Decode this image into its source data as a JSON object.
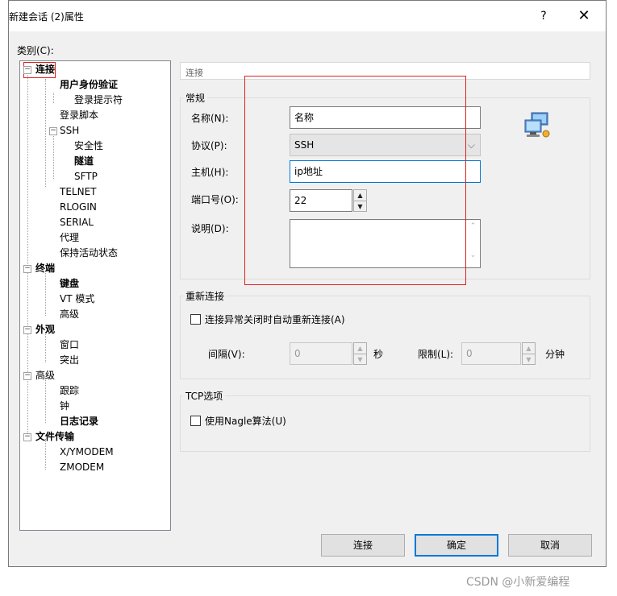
{
  "window": {
    "title": "新建会话 (2)属性",
    "help": "?",
    "close": "✕"
  },
  "category_label": "类别(C):",
  "tree": {
    "connection": "连接",
    "auth": "用户身份验证",
    "login_prompt": "登录提示符",
    "login_script": "登录脚本",
    "ssh": "SSH",
    "security": "安全性",
    "tunnel": "隧道",
    "sftp": "SFTP",
    "telnet": "TELNET",
    "rlogin": "RLOGIN",
    "serial": "SERIAL",
    "proxy": "代理",
    "keepalive": "保持活动状态",
    "terminal": "终端",
    "keyboard": "键盘",
    "vt_mode": "VT 模式",
    "term_advanced": "高级",
    "appearance": "外观",
    "window": "窗口",
    "highlight": "突出",
    "advanced": "高级",
    "trace": "跟踪",
    "bell": "钟",
    "logging": "日志记录",
    "file_transfer": "文件传输",
    "xymodem": "X/YMODEM",
    "zmodem": "ZMODEM"
  },
  "panel": {
    "header": "连接"
  },
  "general": {
    "title": "常规",
    "name_label": "名称(N):",
    "name_value": "名称",
    "protocol_label": "协议(P):",
    "protocol_value": "SSH",
    "host_label": "主机(H):",
    "host_value": "ip地址",
    "port_label": "端口号(O):",
    "port_value": "22",
    "desc_label": "说明(D):",
    "desc_value": ""
  },
  "reconnect": {
    "title": "重新连接",
    "auto_label": "连接异常关闭时自动重新连接(A)",
    "auto_checked": false,
    "interval_label": "间隔(V):",
    "interval_value": "0",
    "interval_unit": "秒",
    "limit_label": "限制(L):",
    "limit_value": "0",
    "limit_unit": "分钟"
  },
  "tcp": {
    "title": "TCP选项",
    "nagle_label": "使用Nagle算法(U)",
    "nagle_checked": false
  },
  "buttons": {
    "connect": "连接",
    "ok": "确定",
    "cancel": "取消"
  },
  "watermark": "CSDN @小新爱编程",
  "colors": {
    "accent": "#0078d7",
    "highlight_box": "#e02020"
  }
}
